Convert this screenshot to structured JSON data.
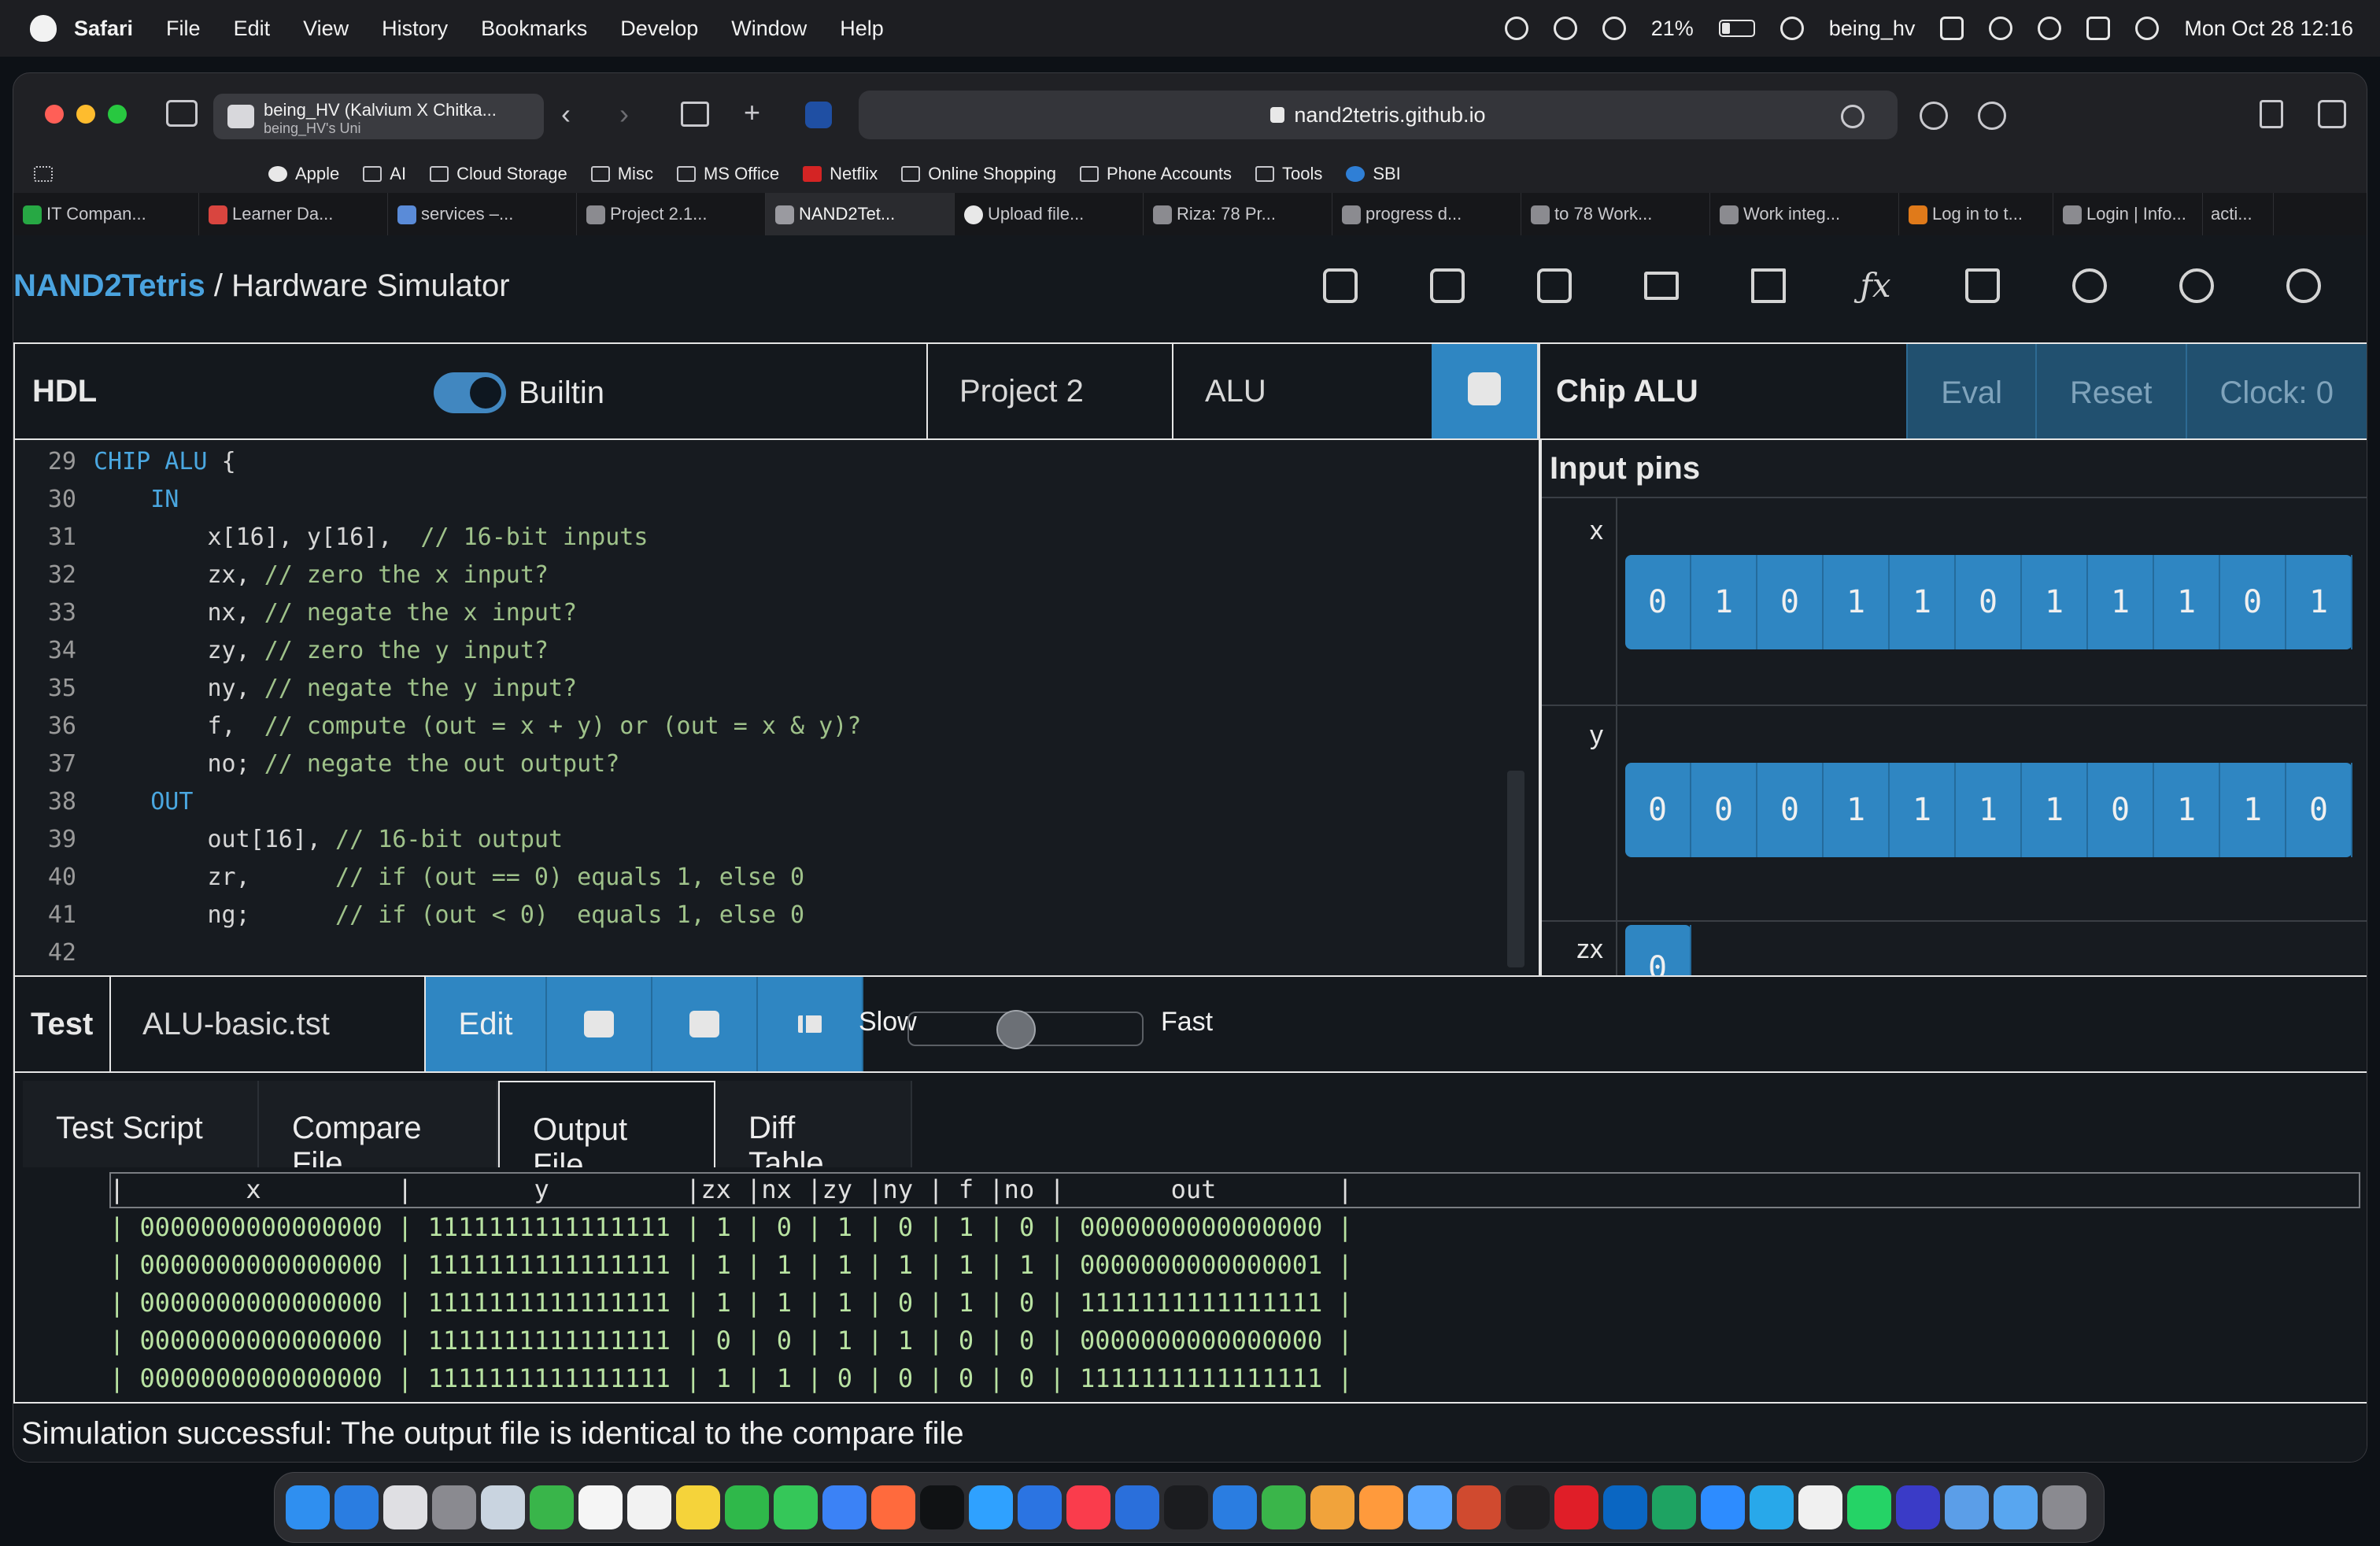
{
  "menubar": {
    "app": "Safari",
    "items": [
      "File",
      "Edit",
      "View",
      "History",
      "Bookmarks",
      "Develop",
      "Window",
      "Help"
    ],
    "battery": "21%",
    "user": "being_hv",
    "datetime": "Mon Oct 28  12:16"
  },
  "safari": {
    "tabgroup_title": "being_HV (Kalvium X Chitka...",
    "tabgroup_subtitle": "being_HV's Uni",
    "url": "nand2tetris.github.io",
    "favorites": [
      "Apple",
      "AI",
      "Cloud Storage",
      "Misc",
      "MS Office",
      "Netflix",
      "Online Shopping",
      "Phone Accounts",
      "Tools",
      "SBI"
    ],
    "tabs": [
      "IT Compan...",
      "Learner Da...",
      "services –...",
      "Project 2.1...",
      "NAND2Tet...",
      "Upload file...",
      "Riza: 78 Pr...",
      "progress d...",
      "to 78 Work...",
      "Work integ...",
      "Log in to t...",
      "Login | Info...",
      "acti..."
    ]
  },
  "app": {
    "brand_link": "NAND2Tetris",
    "brand_sep": " / ",
    "brand_page": "Hardware Simulator",
    "nav_icons": [
      "chip-icon",
      "cpu-icon",
      "asm-icon",
      "computer-icon",
      "grid-icon",
      "fx-icon",
      "book-icon",
      "bug-icon",
      "settings-icon",
      "info-icon"
    ]
  },
  "hdl": {
    "title": "HDL",
    "builtin_label": "Builtin",
    "builtin_on": true,
    "project": "Project 2",
    "chip": "ALU",
    "code_lines": [
      {
        "n": "29",
        "parts": [
          [
            "kw",
            "CHIP ALU "
          ],
          [
            "tx",
            "{"
          ]
        ]
      },
      {
        "n": "30",
        "parts": [
          [
            "tx",
            "    "
          ],
          [
            "kw",
            "IN"
          ]
        ]
      },
      {
        "n": "31",
        "parts": [
          [
            "tx",
            "        x[16], y[16],  "
          ],
          [
            "cm",
            "// 16-bit inputs"
          ]
        ]
      },
      {
        "n": "32",
        "parts": [
          [
            "tx",
            "        zx, "
          ],
          [
            "cm",
            "// zero the x input?"
          ]
        ]
      },
      {
        "n": "33",
        "parts": [
          [
            "tx",
            "        nx, "
          ],
          [
            "cm",
            "// negate the x input?"
          ]
        ]
      },
      {
        "n": "34",
        "parts": [
          [
            "tx",
            "        zy, "
          ],
          [
            "cm",
            "// zero the y input?"
          ]
        ]
      },
      {
        "n": "35",
        "parts": [
          [
            "tx",
            "        ny, "
          ],
          [
            "cm",
            "// negate the y input?"
          ]
        ]
      },
      {
        "n": "36",
        "parts": [
          [
            "tx",
            "        f,  "
          ],
          [
            "cm",
            "// compute (out = x + y) or (out = x & y)?"
          ]
        ]
      },
      {
        "n": "37",
        "parts": [
          [
            "tx",
            "        no; "
          ],
          [
            "cm",
            "// negate the out output?"
          ]
        ]
      },
      {
        "n": "38",
        "parts": [
          [
            "tx",
            "    "
          ],
          [
            "kw",
            "OUT"
          ]
        ]
      },
      {
        "n": "39",
        "parts": [
          [
            "tx",
            "        out[16], "
          ],
          [
            "cm",
            "// 16-bit output"
          ]
        ]
      },
      {
        "n": "40",
        "parts": [
          [
            "tx",
            "        zr,      "
          ],
          [
            "cm",
            "// if (out == 0) equals 1, else 0"
          ]
        ]
      },
      {
        "n": "41",
        "parts": [
          [
            "tx",
            "        ng;      "
          ],
          [
            "cm",
            "// if (out < 0)  equals 1, else 0"
          ]
        ]
      },
      {
        "n": "42",
        "parts": [
          [
            "tx",
            ""
          ]
        ]
      }
    ]
  },
  "chip": {
    "title": "Chip ALU",
    "eval": "Eval",
    "reset": "Reset",
    "clock": "Clock: 0",
    "input_pins_title": "Input pins",
    "pins": [
      {
        "name": "x",
        "bits": [
          "0",
          "1",
          "0",
          "1",
          "1",
          "0",
          "1",
          "1",
          "1",
          "0",
          "1"
        ]
      },
      {
        "name": "y",
        "bits": [
          "0",
          "0",
          "0",
          "1",
          "1",
          "1",
          "1",
          "0",
          "1",
          "1",
          "0"
        ]
      },
      {
        "name": "zx",
        "bits": [
          "0"
        ]
      }
    ]
  },
  "test": {
    "title": "Test",
    "file": "ALU-basic.tst",
    "edit": "Edit",
    "slow": "Slow",
    "fast": "Fast",
    "speed_fraction": 0.45,
    "tabs": [
      "Test Script",
      "Compare File",
      "Output File",
      "Diff Table"
    ],
    "active_tab": "Output File",
    "output_header": "|        x         |        y         |zx |nx |zy |ny | f |no |       out        |",
    "output_rows": [
      "| 0000000000000000 | 1111111111111111 | 1 | 0 | 1 | 0 | 1 | 0 | 0000000000000000 |",
      "| 0000000000000000 | 1111111111111111 | 1 | 1 | 1 | 1 | 1 | 1 | 0000000000000001 |",
      "| 0000000000000000 | 1111111111111111 | 1 | 1 | 1 | 0 | 1 | 0 | 1111111111111111 |",
      "| 0000000000000000 | 1111111111111111 | 0 | 0 | 1 | 1 | 0 | 0 | 0000000000000000 |",
      "| 0000000000000000 | 1111111111111111 | 1 | 1 | 0 | 0 | 0 | 0 | 1111111111111111 |"
    ]
  },
  "status": "Simulation successful: The output file is identical to the compare file",
  "colors": {
    "accent": "#2f86c2",
    "brand_link": "#4aa3df",
    "keyword": "#4aa7e0",
    "comment": "#9fc28a",
    "output_text": "#b9e3a2"
  }
}
